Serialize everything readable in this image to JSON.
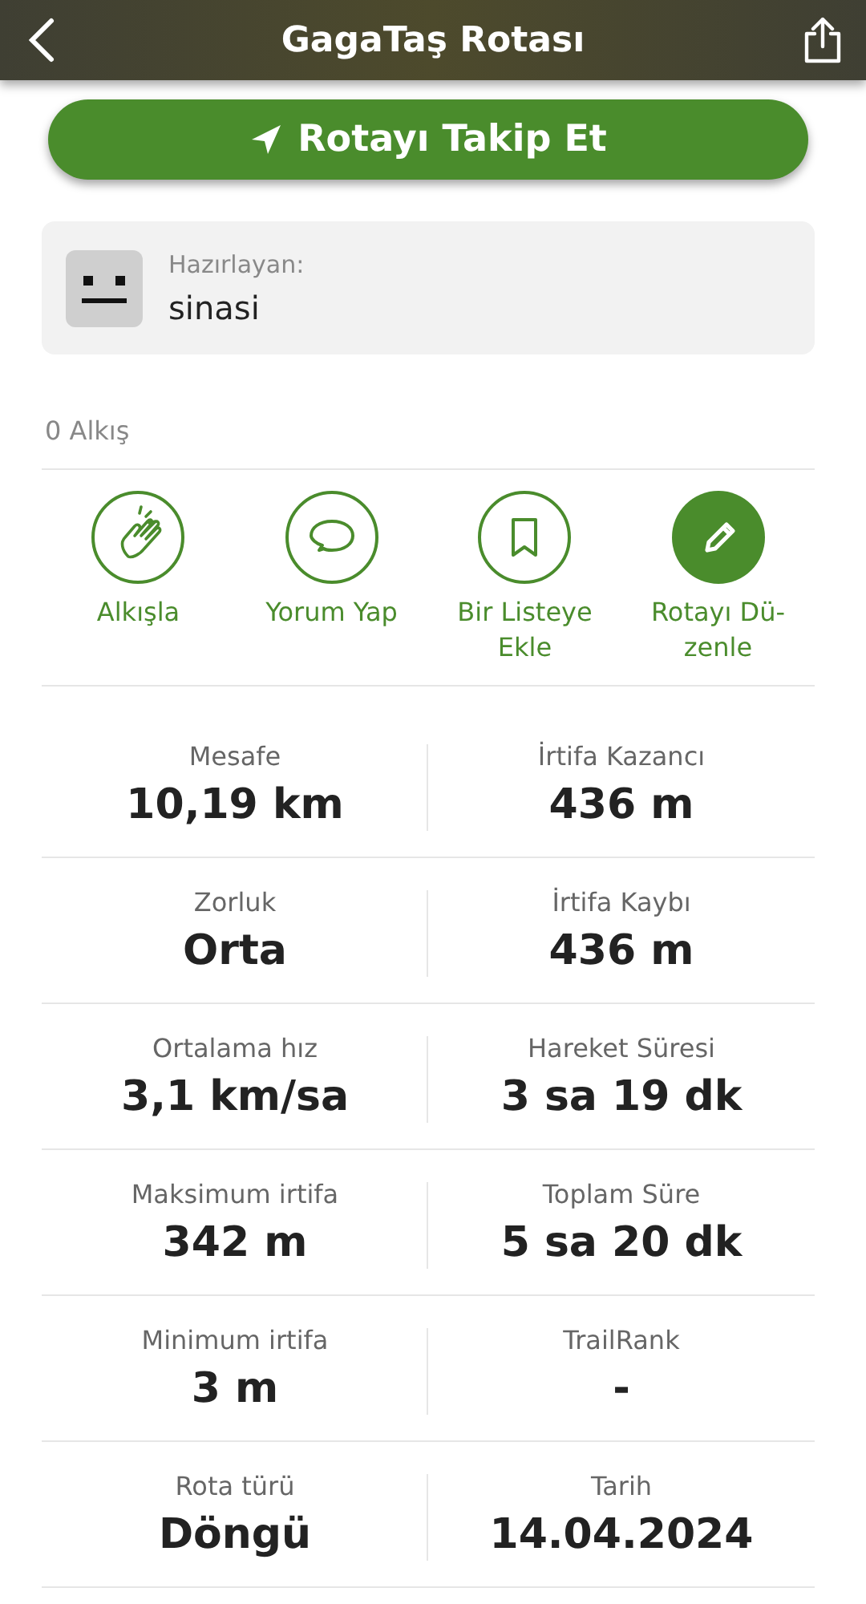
{
  "header": {
    "title": "GagaTaş Rotası"
  },
  "follow_button": {
    "label": "Rotayı Takip Et"
  },
  "author": {
    "caption": "Hazırlayan:",
    "name": "sinasi"
  },
  "claps": "0 Alkış",
  "actions": [
    {
      "kind": "clap",
      "label": "Alkışla",
      "filled": false
    },
    {
      "kind": "comment",
      "label": "Yorum Yap",
      "filled": false
    },
    {
      "kind": "bookmark",
      "label": "Bir Listeye\nEkle",
      "filled": false
    },
    {
      "kind": "edit",
      "label": "Rotayı Dü-\nzenle",
      "filled": true
    }
  ],
  "stats": [
    {
      "label": "Mesafe",
      "value": "10,19 km"
    },
    {
      "label": "İrtifa Kazancı",
      "value": "436 m"
    },
    {
      "label": "Zorluk",
      "value": "Orta"
    },
    {
      "label": "İrtifa Kaybı",
      "value": "436 m"
    },
    {
      "label": "Ortalama hız",
      "value": "3,1 km/sa"
    },
    {
      "label": "Hareket Süresi",
      "value": "3 sa 19 dk"
    },
    {
      "label": "Maksimum irtifa",
      "value": "342 m"
    },
    {
      "label": "Toplam Süre",
      "value": "5 sa 20 dk"
    },
    {
      "label": "Minimum irtifa",
      "value": "3 m"
    },
    {
      "label": "TrailRank",
      "value": "-"
    },
    {
      "label": "Rota türü",
      "value": "Döngü"
    },
    {
      "label": "Tarih",
      "value": "14.04.2024"
    }
  ]
}
